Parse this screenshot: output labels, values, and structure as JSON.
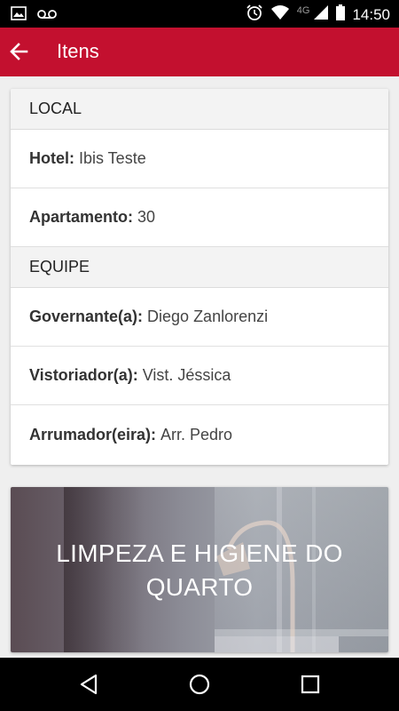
{
  "status_bar": {
    "time": "14:50",
    "network": "4G",
    "icons": [
      "image-icon",
      "voicemail-icon",
      "alarm-icon",
      "wifi-icon",
      "signal-icon",
      "battery-icon"
    ]
  },
  "app_bar": {
    "title": "Itens",
    "back_icon": "arrow-back-icon",
    "color": "#c3102f"
  },
  "sections": [
    {
      "header": "LOCAL",
      "rows": [
        {
          "label": "Hotel:",
          "value": "Ibis Teste"
        },
        {
          "label": "Apartamento:",
          "value": "30"
        }
      ]
    },
    {
      "header": "EQUIPE",
      "rows": [
        {
          "label": "Governante(a):",
          "value": "Diego Zanlorenzi"
        },
        {
          "label": "Vistoriador(a):",
          "value": "Vist. Jéssica"
        },
        {
          "label": "Arrumador(eira):",
          "value": "Arr. Pedro"
        }
      ]
    }
  ],
  "banner": {
    "title_line1": "LIMPEZA E HIGIENE DO",
    "title_line2": "QUARTO"
  },
  "nav_bar": {
    "icons": [
      "back-triangle-icon",
      "home-circle-icon",
      "recents-square-icon"
    ]
  }
}
